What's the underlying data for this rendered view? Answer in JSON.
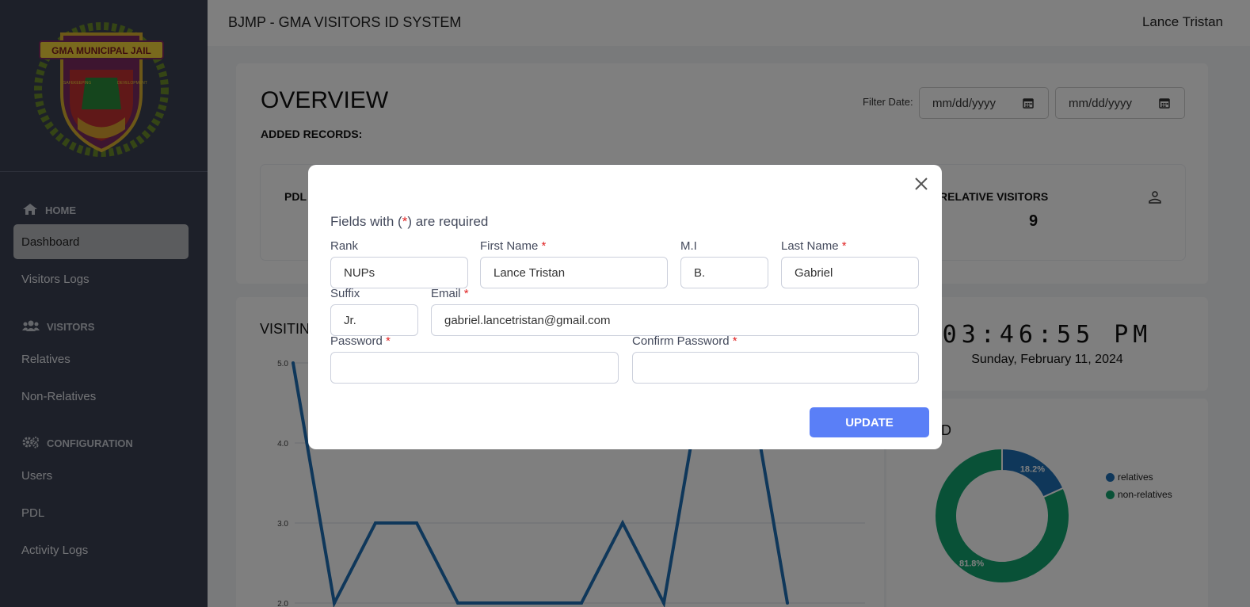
{
  "app": {
    "title": "BJMP - GMA VISITORS ID SYSTEM",
    "user_name": "Lance Tristan",
    "logo_text": "GMA MUNICIPAL JAIL",
    "logo_motto_left": "SAFEKEEPING",
    "logo_motto_right": "DEVELOPMENT"
  },
  "sidebar": {
    "sections": [
      {
        "label": "HOME",
        "icon": "home-icon"
      },
      {
        "label": "VISITORS",
        "icon": "users-icon"
      },
      {
        "label": "CONFIGURATION",
        "icon": "gears-icon"
      }
    ],
    "items": [
      {
        "label": "Dashboard",
        "active": true
      },
      {
        "label": "Visitors Logs"
      },
      {
        "label": "Relatives"
      },
      {
        "label": "Non-Relatives"
      },
      {
        "label": "Users"
      },
      {
        "label": "PDL"
      },
      {
        "label": "Activity Logs"
      }
    ]
  },
  "overview": {
    "title": "OVERVIEW",
    "added_records": "ADDED RECORDS:",
    "filter_label": "Filter Date:",
    "date_placeholder_1": "mm/dd/yyyy",
    "date_placeholder_2": "mm/dd/yyyy"
  },
  "stats": {
    "pdl_label": "PDL",
    "relative_visitors_label": "RELATIVE VISITORS",
    "relative_visitors_value": "9"
  },
  "visiting_chart": {
    "title_visible": "VISITIN",
    "ytick_labels": [
      "5.0",
      "4.0",
      "3.0",
      "2.0"
    ]
  },
  "clock": {
    "time": "03:46:55 PM",
    "date": "Sunday, February 11, 2024"
  },
  "id_chart": {
    "title_visible": "IVE ID",
    "legend": [
      "relatives",
      "non-relatives"
    ],
    "labels": [
      "18.2%",
      "81.8%"
    ]
  },
  "chart_data": [
    {
      "type": "line",
      "title": "VISITIN",
      "ylim": [
        2.0,
        5.0
      ],
      "yticks": [
        5.0,
        4.0,
        3.0,
        2.0
      ],
      "grid": true,
      "series": [
        {
          "values": [
            5,
            2,
            3,
            3,
            2,
            2,
            2,
            2,
            3,
            2,
            5,
            5,
            2
          ]
        }
      ]
    },
    {
      "type": "pie",
      "title": "IVE ID",
      "categories": [
        "relatives",
        "non-relatives"
      ],
      "values": [
        18.2,
        81.8
      ],
      "legend_position": "right"
    }
  ],
  "colors": {
    "sidebar_bg": "#3a4053",
    "accent_button": "#5a7ff7",
    "series_relatives": "#1f6fb5",
    "series_nonrelatives": "#12a36e",
    "line_series": "#1f6fb5",
    "required_star": "#e02424"
  },
  "modal": {
    "required_note_prefix": "Fields with (",
    "required_note_star": "*",
    "required_note_suffix": ") are required",
    "labels": {
      "rank": "Rank",
      "first_name": "First Name",
      "mi": "M.I",
      "last_name": "Last Name",
      "suffix": "Suffix",
      "email": "Email",
      "password": "Password",
      "confirm_password": "Confirm Password",
      "star": "*"
    },
    "values": {
      "rank": "NUPs",
      "first_name": "Lance Tristan",
      "mi": "B.",
      "last_name": "Gabriel",
      "suffix": "Jr.",
      "email": "gabriel.lancetristan@gmail.com",
      "password": "",
      "confirm_password": ""
    },
    "update_label": "UPDATE"
  }
}
